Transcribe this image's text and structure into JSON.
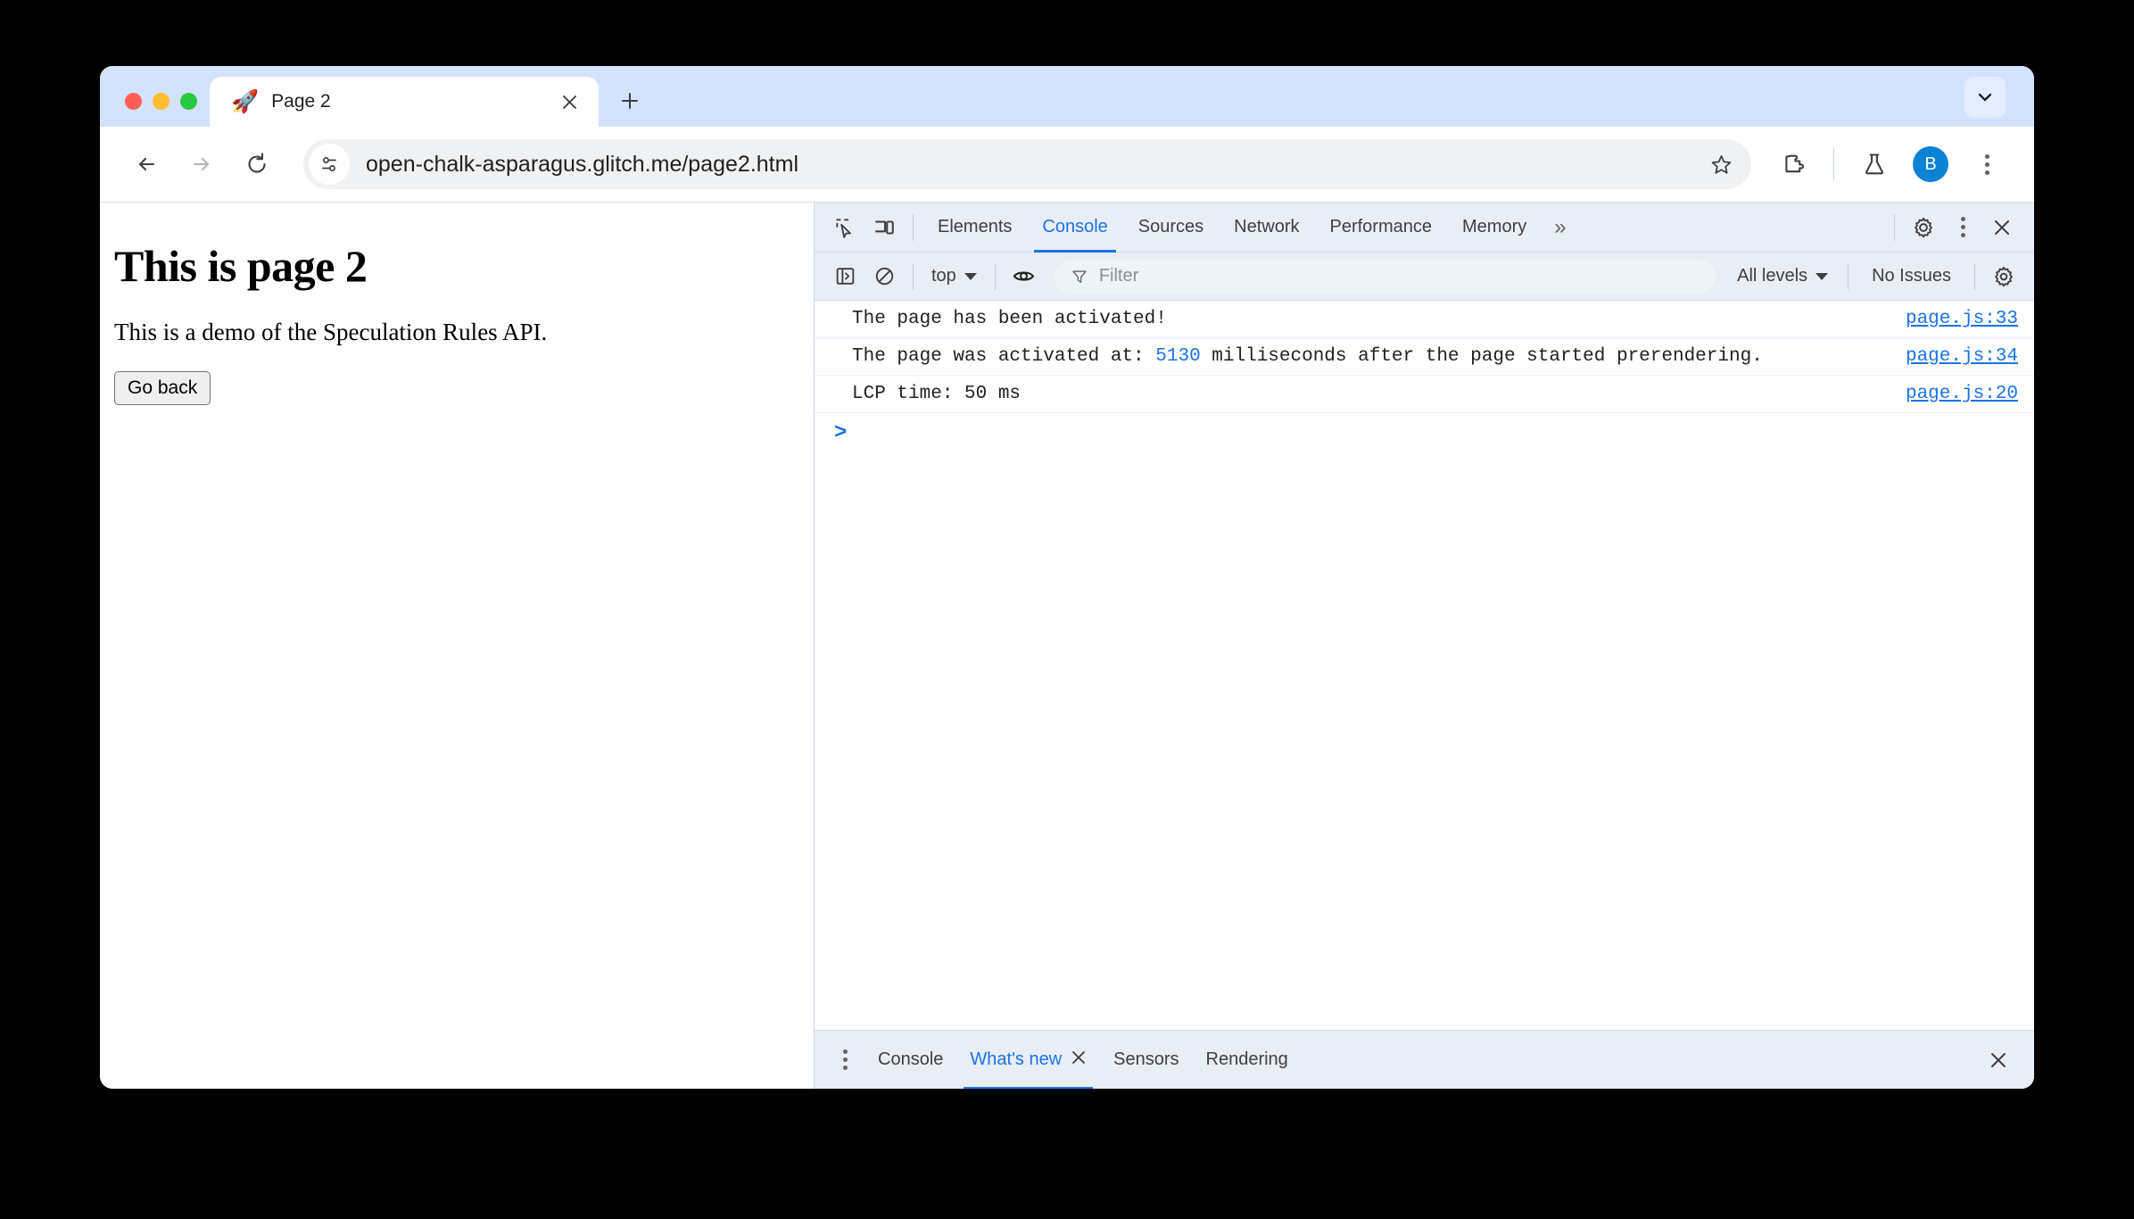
{
  "browser": {
    "tab": {
      "favicon": "rocket-emoji",
      "title": "Page 2",
      "close_label": "✕"
    },
    "new_tab_label": "+",
    "omnibox": {
      "url": "open-chalk-asparagus.glitch.me/page2.html"
    },
    "profile_initial": "B"
  },
  "page": {
    "heading": "This is page 2",
    "paragraph": "This is a demo of the Speculation Rules API.",
    "button_label": "Go back"
  },
  "devtools": {
    "tabs": [
      {
        "label": "Elements",
        "active": false
      },
      {
        "label": "Console",
        "active": true
      },
      {
        "label": "Sources",
        "active": false
      },
      {
        "label": "Network",
        "active": false
      },
      {
        "label": "Performance",
        "active": false
      },
      {
        "label": "Memory",
        "active": false
      }
    ],
    "overflow_label": "»",
    "console_toolbar": {
      "context": "top",
      "filter_placeholder": "Filter",
      "levels": "All levels",
      "issues": "No Issues"
    },
    "console_messages": [
      {
        "text_before": "The page has been activated!",
        "value": "",
        "text_after": "",
        "source": "page.js:33"
      },
      {
        "text_before": "The page was activated at: ",
        "value": "5130",
        "text_after": "  milliseconds after the page started prerendering.",
        "source": "page.js:34"
      },
      {
        "text_before": "LCP time: 50 ms",
        "value": "",
        "text_after": "",
        "source": "page.js:20"
      }
    ],
    "prompt_symbol": ">",
    "drawer_tabs": [
      {
        "label": "Console",
        "active": false,
        "closable": false
      },
      {
        "label": "What's new",
        "active": true,
        "closable": true
      },
      {
        "label": "Sensors",
        "active": false,
        "closable": false
      },
      {
        "label": "Rendering",
        "active": false,
        "closable": false
      }
    ]
  },
  "colors": {
    "accent_blue": "#1a73e8",
    "tab_strip_blue": "#d3e3fd",
    "devtools_chrome": "#e9eef6",
    "avatar_blue": "#0b82d4"
  }
}
